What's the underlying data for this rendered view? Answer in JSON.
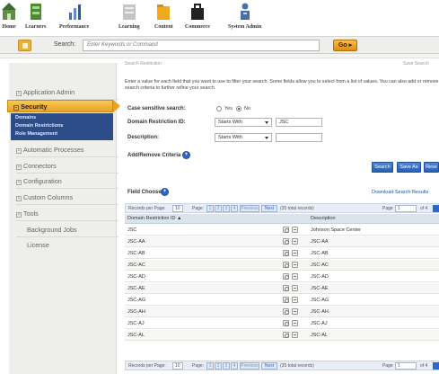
{
  "nav": {
    "items": [
      {
        "label": "Home",
        "icon": "home-icon",
        "color": "#4a7c3a"
      },
      {
        "label": "Learners",
        "icon": "learners-icon",
        "color": "#4b8a2e"
      },
      {
        "label": "Performance",
        "icon": "performance-icon",
        "color": "#3b6fb6"
      },
      {
        "label": "Learning",
        "icon": "learning-icon",
        "color": "#b0b0b0"
      },
      {
        "label": "Content",
        "icon": "content-icon",
        "color": "#f0a81c"
      },
      {
        "label": "Commerce",
        "icon": "commerce-icon",
        "color": "#222222"
      },
      {
        "label": "System Admin",
        "icon": "system-admin-icon",
        "color": "#4a6fa8"
      }
    ]
  },
  "search": {
    "label": "Search:",
    "placeholder": "Enter Keywords or Command",
    "go_label": "Go ▸"
  },
  "sidebar": {
    "items": [
      "Application Admin",
      "Security",
      "Automatic Processes",
      "Connectors",
      "Configuration",
      "Custom Columns",
      "Tools",
      "Background Jobs",
      "License"
    ],
    "security_sub": [
      "Domains",
      "Domain Restrictions",
      "Role Management"
    ],
    "accent": "#eaa123",
    "sub_bg": "#2d4d88"
  },
  "content": {
    "crumb_left": "Search Restriction",
    "crumb_right": "Save Search",
    "intro": "Enter a value for each field that you want to use to filter your search. Some fields allow you to select from a list of values. You can also add or remove search criteria to further refine your search.",
    "case_label": "Case sensitive search:",
    "case_yes": "Yes",
    "case_no": "No",
    "case_selected": "No",
    "dr_label": "Domain Restriction ID:",
    "dr_op": "Starts With",
    "dr_value": "JSC",
    "desc_label": "Description:",
    "desc_op": "Starts With",
    "desc_value": "",
    "add_remove": "Add/Remove Criteria",
    "buttons": {
      "search": "Search",
      "save_as": "Save As",
      "reset": "Rese"
    },
    "field_chooser": "Field Chooser",
    "download": "Download Search Results",
    "pager": {
      "records_label": "Records per Page:",
      "records_value": "10",
      "page_label": "Page:",
      "pages": [
        "1",
        "2",
        "3",
        "4"
      ],
      "prev": "Previous",
      "next": "Next",
      "total": "(35 total records)",
      "page_right_label": "Page",
      "page_right_value": "1",
      "of_label": "of 4"
    },
    "table": {
      "headers": [
        "Domain Restriction ID ▲",
        "Description"
      ],
      "rows": [
        [
          "JSC",
          "Johnson Space Center"
        ],
        [
          "JSC-AA",
          "JSC-AA"
        ],
        [
          "JSC-AB",
          "JSC-AB"
        ],
        [
          "JSC-AC",
          "JSC-AC"
        ],
        [
          "JSC-AD",
          "JSC-AD"
        ],
        [
          "JSC-AE",
          "JSC-AE"
        ],
        [
          "JSC-AG",
          "JSC-AG"
        ],
        [
          "JSC-AH",
          "JSC-AH"
        ],
        [
          "JSC-AJ",
          "JSC-AJ"
        ],
        [
          "JSC-AL",
          "JSC-AL"
        ]
      ]
    }
  }
}
